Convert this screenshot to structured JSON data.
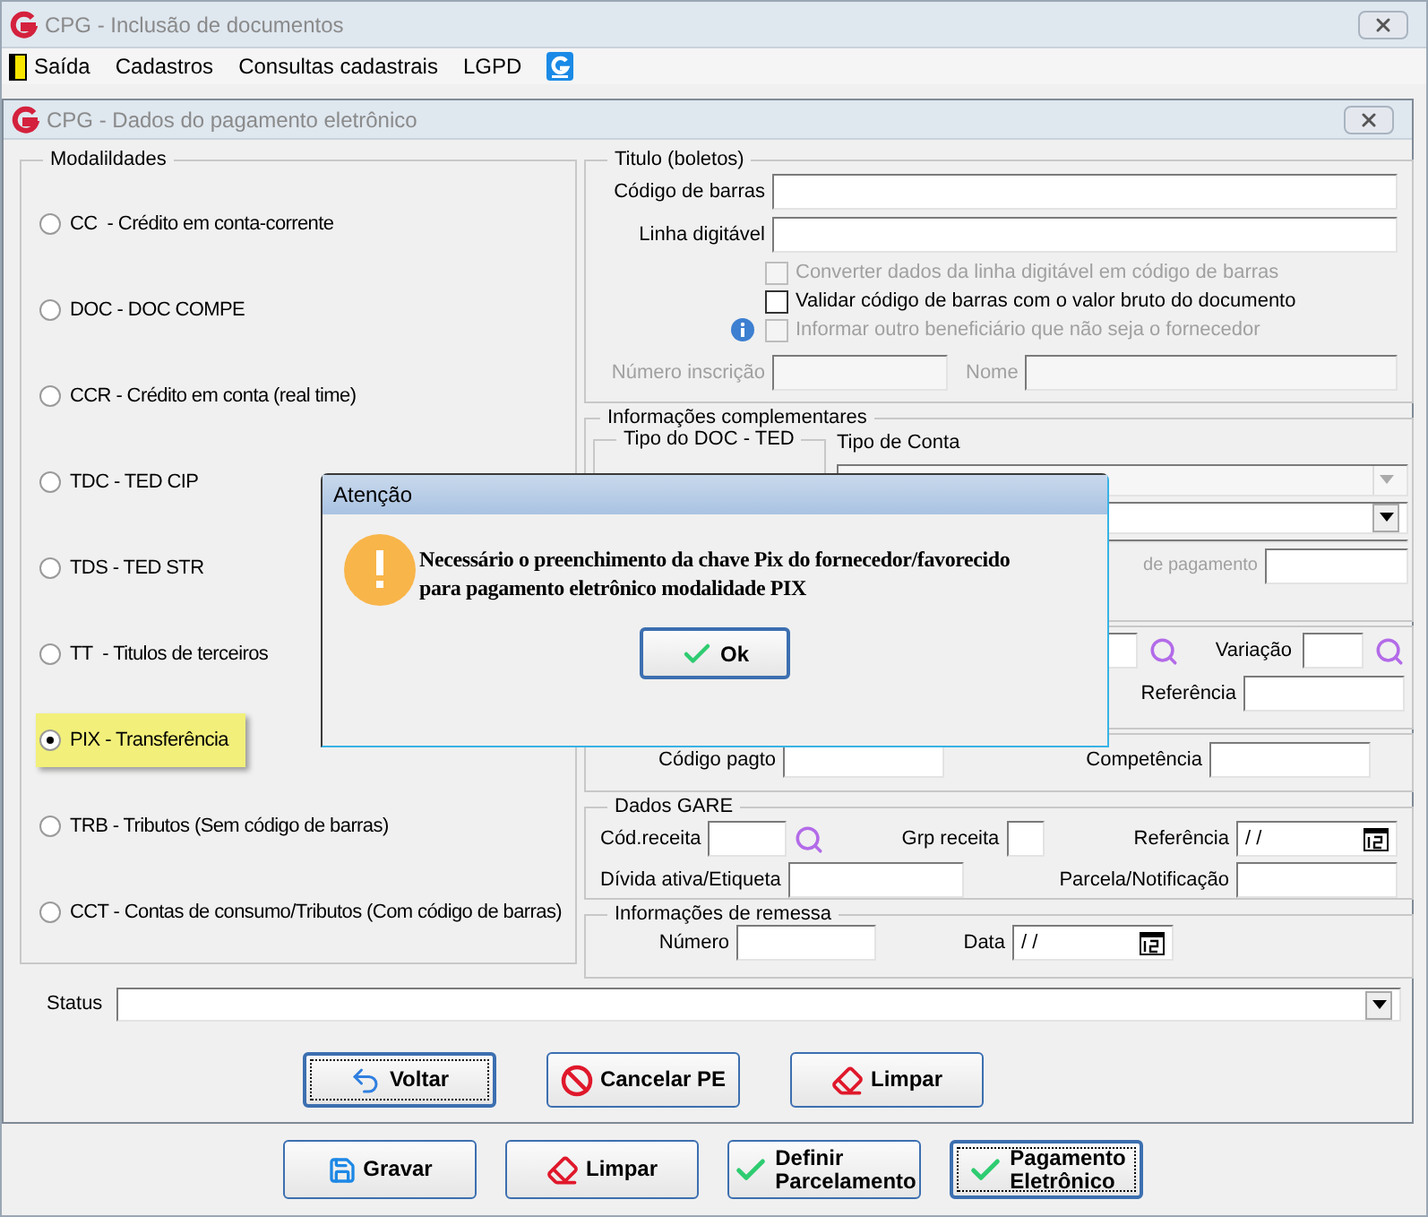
{
  "app_window": {
    "title": "CPG - Inclusão de documentos"
  },
  "menu": [
    "Saída",
    "Cadastros",
    "Consultas cadastrais",
    "LGPD"
  ],
  "dialog_window": {
    "title": "CPG - Dados do pagamento eletrônico"
  },
  "modalidades": {
    "title": "Modalildades",
    "options": [
      {
        "label": "CC  - Crédito em conta-corrente",
        "selected": false
      },
      {
        "label": "DOC - DOC COMPE",
        "selected": false
      },
      {
        "label": "CCR - Crédito em conta (real time)",
        "selected": false
      },
      {
        "label": "TDC - TED CIP",
        "selected": false
      },
      {
        "label": "TDS - TED STR",
        "selected": false
      },
      {
        "label": "TT  - Titulos de terceiros",
        "selected": false
      },
      {
        "label": "PIX - Transferência",
        "selected": true
      },
      {
        "label": "TRB - Tributos (Sem código de barras)",
        "selected": false
      },
      {
        "label": "CCT - Contas de consumo/Tributos (Com código de barras)",
        "selected": false
      }
    ]
  },
  "titulo": {
    "title": "Titulo (boletos)",
    "fields": [
      {
        "label": "Código de barras"
      },
      {
        "label": "Linha digitável"
      }
    ],
    "checkboxes": [
      {
        "label": "Converter dados da linha digitável em código de barras",
        "checked": false,
        "disabled": true,
        "info": false
      },
      {
        "label": "Validar código de barras com o valor bruto do documento",
        "checked": false,
        "disabled": false,
        "info": false
      },
      {
        "label": "Informar outro beneficiário que não seja o fornecedor",
        "checked": false,
        "disabled": true,
        "info": true
      }
    ],
    "numero_inscricao": {
      "label": "Número inscrição",
      "disabled": true
    },
    "nome": {
      "label": "Nome",
      "disabled": true
    }
  },
  "complementares": {
    "title": "Informações complementares",
    "tipo_doc_ted": {
      "title": "Tipo do DOC - TED"
    },
    "tipo_conta": {
      "label": "Tipo de Conta"
    },
    "pagamento_label": "de pagamento"
  },
  "conta": {
    "variacao": "Variação",
    "referencia": "Referência"
  },
  "tributo": {
    "codigo_pagto": "Código pagto",
    "competencia": "Competência"
  },
  "gare": {
    "title": "Dados GARE",
    "cod_receita": "Cód.receita",
    "grp_receita": "Grp receita",
    "referencia": {
      "label": "Referência",
      "value": "/ /"
    },
    "divida": "Dívida ativa/Etiqueta",
    "parcela": "Parcela/Notificação"
  },
  "remessa": {
    "title": "Informações de remessa",
    "numero": "Número",
    "data": {
      "label": "Data",
      "value": "/ /"
    }
  },
  "status": {
    "label": "Status"
  },
  "dialog_buttons": [
    {
      "label": "Voltar",
      "kind": "back",
      "focused": true
    },
    {
      "label": "Cancelar PE",
      "kind": "cancel",
      "focused": false
    },
    {
      "label": "Limpar",
      "kind": "eraser",
      "focused": false
    }
  ],
  "window_buttons": [
    {
      "label": "Gravar",
      "kind": "save",
      "focused": false
    },
    {
      "label": "Limpar",
      "kind": "eraser",
      "focused": false
    },
    {
      "label": "Definir\nParcelamento",
      "kind": "check",
      "focused": false
    },
    {
      "label": "Pagamento\nEletrônico",
      "kind": "check",
      "focused": true
    }
  ],
  "alert": {
    "title": "Atenção",
    "message": "Necessário o preenchimento da chave Pix do fornecedor/favorecido\npara pagamento eletrônico modalidade PIX",
    "button": {
      "label": "Ok"
    }
  }
}
